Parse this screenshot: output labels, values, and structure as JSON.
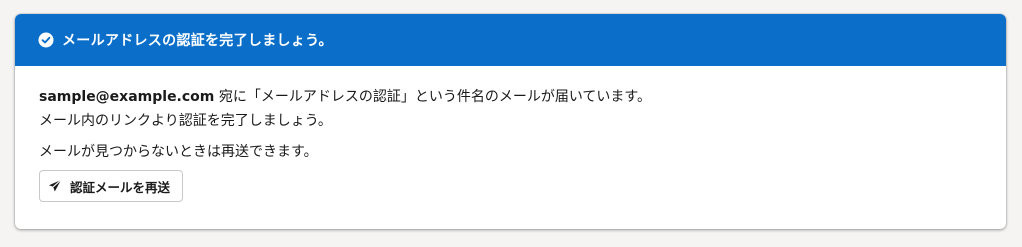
{
  "header": {
    "icon": "check-circle-icon",
    "title": "メールアドレスの認証を完了しましょう。"
  },
  "body": {
    "email": "sample@example.com",
    "message_line1_suffix": " 宛に「メールアドレスの認証」という件名のメールが届いています。",
    "message_line2": "メール内のリンクより認証を完了しましょう。",
    "message_line3": "メールが見つからないときは再送できます。"
  },
  "resend_button": {
    "icon": "paper-plane-icon",
    "label": "認証メールを再送"
  },
  "colors": {
    "header_bg": "#0b6fc9",
    "header_text": "#ffffff",
    "page_bg": "#f5f4f3"
  }
}
